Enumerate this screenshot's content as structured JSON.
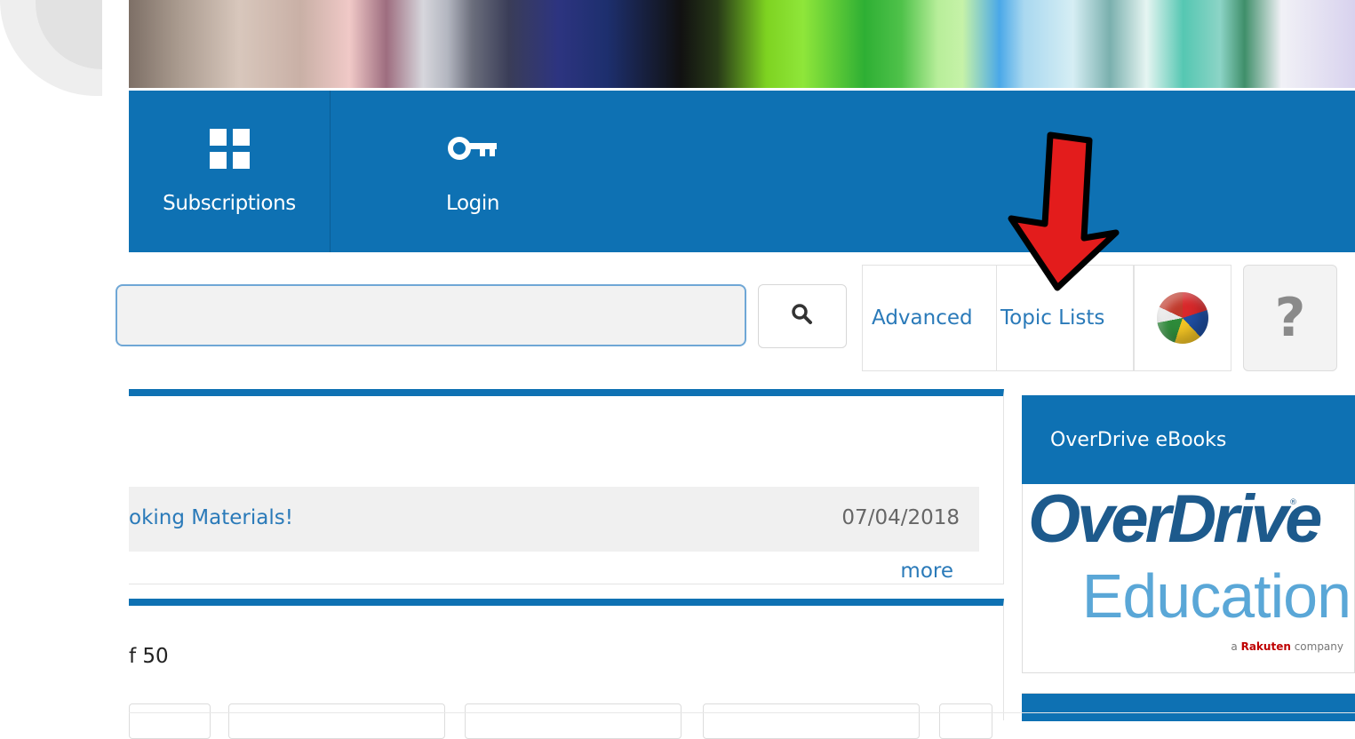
{
  "nav": {
    "items": [
      {
        "label": "Subscriptions",
        "icon": "grid-icon"
      },
      {
        "label": "Login",
        "icon": "key-icon"
      }
    ],
    "background": "#0e71b3"
  },
  "search": {
    "value": "",
    "placeholder": "",
    "button_icon": "search-icon"
  },
  "tools": {
    "advanced_label": "Advanced",
    "topic_lists_label": "Topic Lists",
    "language_icon": "globe-flags-icon",
    "help_label": "?"
  },
  "annotation": {
    "arrow_icon": "red-arrow-down-icon",
    "arrow_color": "#e31c1c"
  },
  "news": {
    "item_title": "oking Materials!",
    "item_date": "07/04/2018",
    "more_label": "more"
  },
  "list": {
    "count_text": "f 50"
  },
  "sidebar": {
    "header": "OverDrive eBooks",
    "logo": {
      "brand": "OverDrive",
      "registered": "®",
      "product": "Education",
      "tagline_prefix": "a ",
      "tagline_brand": "Rakuten",
      "tagline_suffix": " company"
    }
  }
}
